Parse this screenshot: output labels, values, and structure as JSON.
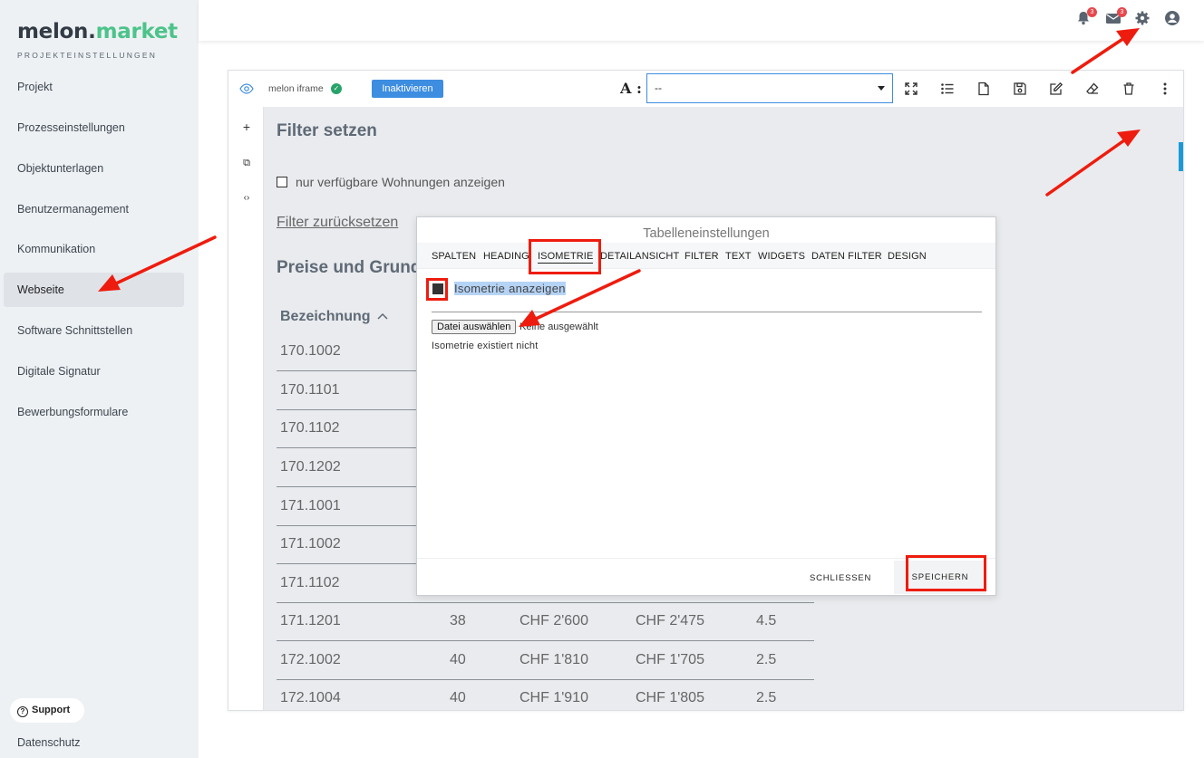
{
  "sidebar": {
    "brand_part1": "melon.",
    "brand_part2": "market",
    "subtitle": "PROJEKTEINSTELLUNGEN",
    "items": [
      {
        "label": "Projekt"
      },
      {
        "label": "Prozesseinstellungen"
      },
      {
        "label": "Objektunterlagen"
      },
      {
        "label": "Benutzermanagement"
      },
      {
        "label": "Kommunikation"
      },
      {
        "label": "Webseite",
        "active": true
      },
      {
        "label": "Software Schnittstellen"
      },
      {
        "label": "Digitale Signatur"
      },
      {
        "label": "Bewerbungsformulare"
      }
    ],
    "support_label": "Support",
    "privacy_label": "Datenschutz"
  },
  "topbar": {
    "notifications_count": "3",
    "messages_count": "3",
    "icons": [
      "bell-icon",
      "mail-icon",
      "gear-icon",
      "user-icon"
    ]
  },
  "editor": {
    "iframe_label": "melon iframe",
    "inactivate_label": "Inaktivieren",
    "font_label": "A :",
    "font_select_value": "--",
    "toolbar_icons": [
      "expand-icon",
      "list-icon",
      "file-icon",
      "save-icon",
      "edit-icon",
      "eraser-icon",
      "trash-icon",
      "more-icon"
    ],
    "left_tools": [
      "+",
      "⧉",
      "‹›"
    ]
  },
  "page": {
    "filter_heading": "Filter setzen",
    "checkbox_label": "nur verfügbare Wohnungen anzeigen",
    "reset_link": "Filter zurücksetzen",
    "prices_heading": "Preise und Grundrisse",
    "column_header": "Bezeichnung",
    "rows": [
      {
        "name": "170.1002",
        "c1": "",
        "c2": "",
        "c3": "",
        "c4": ""
      },
      {
        "name": "170.1101",
        "c1": "",
        "c2": "",
        "c3": "",
        "c4": ""
      },
      {
        "name": "170.1102",
        "c1": "",
        "c2": "",
        "c3": "",
        "c4": ""
      },
      {
        "name": "170.1202",
        "c1": "",
        "c2": "",
        "c3": "",
        "c4": ""
      },
      {
        "name": "171.1001",
        "c1": "",
        "c2": "",
        "c3": "",
        "c4": ""
      },
      {
        "name": "171.1002",
        "c1": "",
        "c2": "",
        "c3": "",
        "c4": ""
      },
      {
        "name": "171.1102",
        "c1": "",
        "c2": "",
        "c3": "",
        "c4": ""
      },
      {
        "name": "171.1201",
        "c1": "38",
        "c2": "CHF 2'600",
        "c3": "CHF 2'475",
        "c4": "4.5"
      },
      {
        "name": "172.1002",
        "c1": "40",
        "c2": "CHF 1'810",
        "c3": "CHF 1'705",
        "c4": "2.5"
      },
      {
        "name": "172.1004",
        "c1": "40",
        "c2": "CHF 1'910",
        "c3": "CHF 1'805",
        "c4": "2.5"
      }
    ]
  },
  "modal": {
    "title": "Tabelleneinstellungen",
    "tabs": [
      "SPALTEN",
      "HEADING",
      "ISOMETRIE",
      "DETAILANSICHT",
      "FILTER",
      "TEXT",
      "WIDGETS",
      "DATEN FILTER",
      "DESIGN"
    ],
    "active_tab": "ISOMETRIE",
    "iso_checkbox_label": "Isometrie anazeigen",
    "file_button": "Datei auswählen",
    "file_status": "Keine ausgewählt",
    "iso_message": "Isometrie existiert nicht",
    "close_label": "SCHLIESSEN",
    "save_label": "SPEICHERN"
  },
  "colors": {
    "brand_green": "#4cc38a",
    "accent_blue": "#1a9bd7",
    "annotation_red": "#ee1c0e",
    "close_orange": "#f25f2d"
  }
}
